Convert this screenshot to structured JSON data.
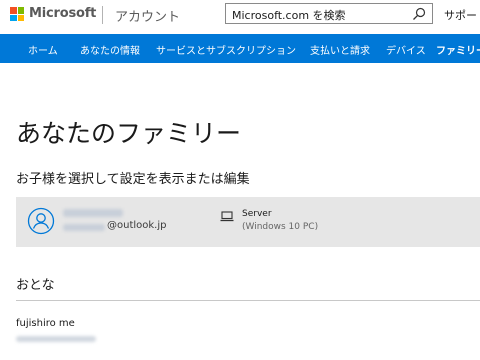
{
  "header": {
    "brand": "Microsoft",
    "section": "アカウント",
    "search_value": "Microsoft.com を検索",
    "support": "サポート"
  },
  "nav": {
    "items": [
      {
        "label": "ホーム"
      },
      {
        "label": "あなたの情報"
      },
      {
        "label": "サービスとサブスクリプション"
      },
      {
        "label": "支払いと請求"
      },
      {
        "label": "デバイス"
      },
      {
        "label": "ファミリー"
      }
    ],
    "active": "ファミリー"
  },
  "page": {
    "title": "あなたのファミリー",
    "subtitle": "お子様を選択して設定を表示または編集"
  },
  "child": {
    "email_suffix": "@outlook.jp",
    "device_name": "Server",
    "device_os": "(Windows 10 PC)"
  },
  "adults": {
    "heading": "おとな",
    "members": [
      {
        "name": "fujishiro me"
      }
    ]
  },
  "colors": {
    "accent": "#0078d7",
    "card_bg": "#e6e6e6"
  },
  "icons": {
    "search": "search-icon",
    "avatar": "person-avatar-icon",
    "device": "laptop-icon"
  }
}
